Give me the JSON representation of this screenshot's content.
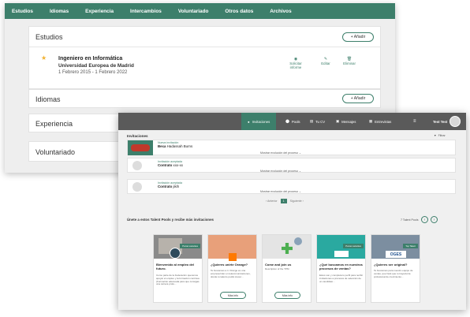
{
  "cv": {
    "nav": [
      "Estudios",
      "Idiomas",
      "Experiencia",
      "Intercambios",
      "Voluntariado",
      "Otros datos",
      "Archivos"
    ],
    "estudios": {
      "title": "Estudios",
      "add": "+ Añadir",
      "entry": {
        "degree": "Ingeniero en Informática",
        "school": "Universidad Europea de Madrid",
        "dates": "1 Febrero 2015 - 1 Febrero 2022",
        "request": "Solicitar informe",
        "edit": "Editar",
        "delete": "Eliminar"
      }
    },
    "idiomas": {
      "title": "Idiomas",
      "add": "+ Añadir"
    },
    "experiencia": {
      "title": "Experiencia"
    },
    "voluntariado": {
      "title": "Voluntariado"
    }
  },
  "app": {
    "nav": {
      "invitaciones": "Invitaciones",
      "pools": "Pools",
      "tu_cv": "Tu CV",
      "mensajes": "Mensajes",
      "entrevistas": "Entrevistas",
      "user": "Test Test"
    },
    "section_title": "Invitaciones",
    "filter": "Filtrar",
    "invites": [
      {
        "status": "Nueva invitación",
        "title": "Beca",
        "detail": "Hadassah Burns",
        "more": "Mostrar evolución del proceso"
      },
      {
        "status": "Invitación aceptada",
        "title": "Contrato",
        "detail": "xxx-xx",
        "more": "Mostrar evolución del proceso"
      },
      {
        "status": "Invitación aceptada",
        "title": "Contrato",
        "detail": "jikih",
        "more": "Mostrar evolución del proceso"
      }
    ],
    "pager": {
      "prev": "‹ Anterior",
      "page": "1",
      "next": "Siguiente ›"
    },
    "pools_title": "Únete a estos Talent Pools y recibe más invitaciones",
    "pools_count": "7 Talent Pools",
    "promos": [
      {
        "title": "Bienvenido al empleo del futuro.",
        "desc": "Como parte de la Federación queremos apoyar el empleo y la formación continua (Formación adecuada para que consigas una carrera profe...",
        "tag": "Pocas vacantes",
        "btn": ""
      },
      {
        "title": "¿Quieres unirte Orange?",
        "desc": "Te buscamos a ti. Orange es una empresa líder en telecomunicaciones, donde tu talento podrá crecer...",
        "tag": "",
        "btn": "Más info"
      },
      {
        "title": "Come and join us",
        "desc": "Description of the TPM",
        "tag": "",
        "btn": "Más info"
      },
      {
        "title": "¿Qué buscamos en nuestros procesos de ventas?",
        "desc": "Estos son y completa tu perfil para recibir invitaciones a procesos de selección de un candidato...",
        "tag": "Pocas vacantes",
        "btn": ""
      },
      {
        "title": "¿Quieres ser original?",
        "desc": "Te buscamos para nuestro equipo de ventas, que hará que tu trayectoria profesional de crecimiento...",
        "tag": "Top Talent",
        "btn": ""
      }
    ],
    "colors": {
      "green": "#3d7f6b",
      "nav": "#5a5a5a",
      "red": "#c0392b"
    }
  }
}
